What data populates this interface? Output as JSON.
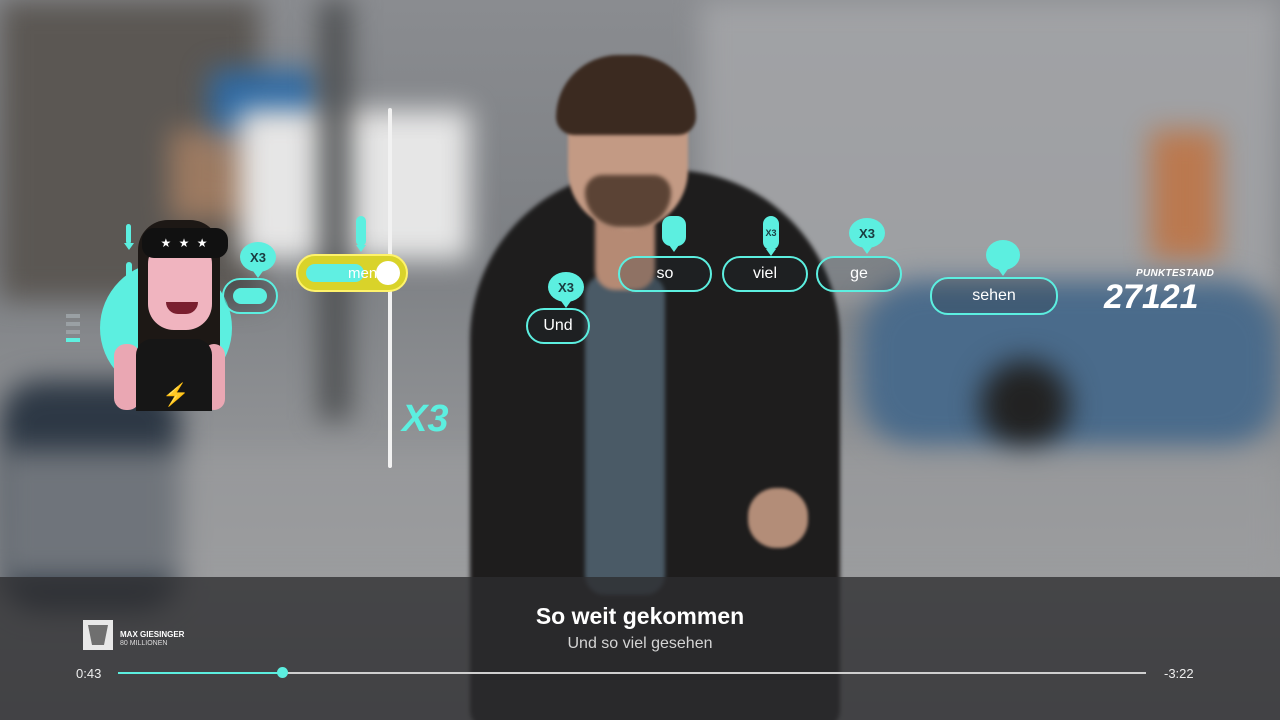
{
  "hud": {
    "score_label": "PUNKTESTAND",
    "score": "27121",
    "multiplier_big": "X3",
    "active_note_text": "men",
    "avatar_bubble": "X3"
  },
  "notes": [
    {
      "text": "Und",
      "bubble": "X3"
    },
    {
      "text": "so",
      "bubble": ""
    },
    {
      "text": "viel",
      "bubble": "X3"
    },
    {
      "text": "ge",
      "bubble": "X3"
    },
    {
      "text": "sehen",
      "bubble": ""
    }
  ],
  "lyrics": {
    "current": "So weit gekommen",
    "next": "Und so viel gesehen"
  },
  "song": {
    "artist": "MAX GIESINGER",
    "title": "80 MILLIONEN"
  },
  "playback": {
    "elapsed": "0:43",
    "remaining": "-3:22",
    "progress": 0.16
  },
  "colors": {
    "accent": "#5cefe0",
    "active_note": "#d9d32a"
  }
}
